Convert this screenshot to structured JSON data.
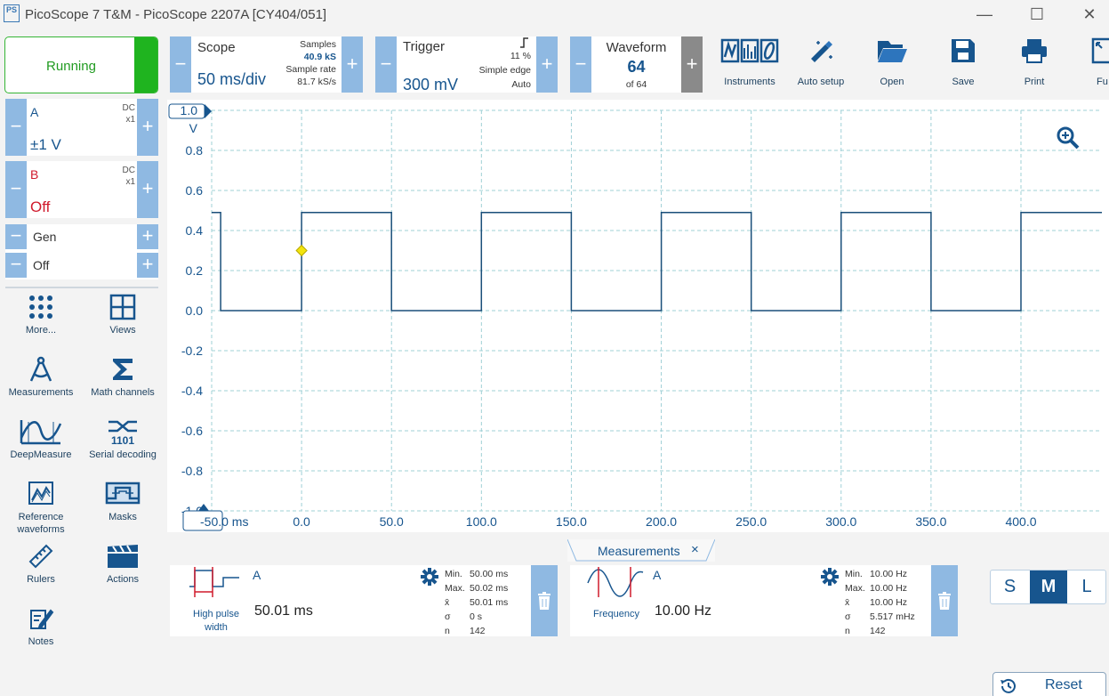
{
  "window": {
    "title": "PicoScope 7 T&M  - PicoScope 2207A [CY404/051]",
    "app_icon_text": "PS",
    "controls": [
      "—",
      "☐",
      "✕"
    ]
  },
  "run_button": {
    "label": "Running",
    "color": "#1fb41f"
  },
  "channels": [
    {
      "name": "A",
      "coupling": "DC",
      "probe": "x1",
      "range": "±1 V",
      "name_color": "#17558e"
    },
    {
      "name": "B",
      "coupling": "DC",
      "probe": "x1",
      "range": "Off",
      "name_color": "#d01a2c"
    }
  ],
  "generator": {
    "label": "Gen",
    "state": "Off"
  },
  "side_tools": [
    {
      "label": "More...",
      "icon": "grid-dots-icon"
    },
    {
      "label": "Views",
      "icon": "views-grid-icon"
    },
    {
      "label": "Measurements",
      "icon": "compass-icon"
    },
    {
      "label": "Math channels",
      "icon": "sigma-icon"
    },
    {
      "label": "DeepMeasure",
      "icon": "deepmeasure-icon"
    },
    {
      "label": "Serial decoding",
      "icon": "serial-decoding-icon"
    },
    {
      "label": "Reference waveforms",
      "icon": "reference-waveform-icon"
    },
    {
      "label": "Masks",
      "icon": "mask-icon"
    },
    {
      "label": "Rulers",
      "icon": "ruler-icon"
    },
    {
      "label": "Actions",
      "icon": "clapperboard-icon"
    },
    {
      "label": "Notes",
      "icon": "notes-icon"
    }
  ],
  "scope_panel": {
    "title": "Scope",
    "timebase": "50 ms/div",
    "samples_label": "Samples",
    "samples": "40.9 kS",
    "rate_label": "Sample rate",
    "rate": "81.7 kS/s"
  },
  "trigger_panel": {
    "title": "Trigger",
    "level": "300 mV",
    "position": "11 %",
    "type": "Simple edge",
    "mode": "Auto"
  },
  "waveform_panel": {
    "title": "Waveform",
    "current": "64",
    "of": "of 64"
  },
  "toolbar": [
    {
      "label": "Instruments",
      "icon": "instruments-icon"
    },
    {
      "label": "Auto setup",
      "icon": "auto-setup-icon"
    },
    {
      "label": "Open",
      "icon": "folder-icon"
    },
    {
      "label": "Save",
      "icon": "save-icon"
    },
    {
      "label": "Print",
      "icon": "print-icon"
    },
    {
      "label": "Fu",
      "icon": "fullscreen-icon"
    }
  ],
  "chart_data": {
    "type": "line",
    "title": "",
    "xlabel": "ms",
    "ylabel": "V",
    "xlim": [
      -50,
      445
    ],
    "ylim": [
      -1.0,
      1.0
    ],
    "x_ticks": [
      "-50.0 ms",
      "0.0",
      "50.0",
      "100.0",
      "150.0",
      "200.0",
      "250.0",
      "300.0",
      "350.0",
      "400.0"
    ],
    "x_tick_values": [
      -50,
      0,
      50,
      100,
      150,
      200,
      250,
      300,
      350,
      400
    ],
    "y_ticks": [
      "1.0",
      "0.8",
      "0.6",
      "0.4",
      "0.2",
      "0.0",
      "-0.2",
      "-0.4",
      "-0.6",
      "-0.8",
      "-1.0"
    ],
    "y_tick_values": [
      1.0,
      0.8,
      0.6,
      0.4,
      0.2,
      0.0,
      -0.2,
      -0.4,
      -0.6,
      -0.8,
      -1.0
    ],
    "grid": true,
    "series": [
      {
        "values_x": [
          -50,
          -45,
          -45,
          0,
          0,
          50,
          50,
          100,
          100,
          150,
          150,
          200,
          200,
          250,
          250,
          300,
          300,
          350,
          350,
          400,
          400,
          445
        ],
        "values_y": [
          0.49,
          0.49,
          0.0,
          0.0,
          0.49,
          0.49,
          0.0,
          0.0,
          0.49,
          0.49,
          0.0,
          0.0,
          0.49,
          0.49,
          0.0,
          0.0,
          0.49,
          0.49,
          0.0,
          0.0,
          0.49,
          0.49
        ],
        "color": "#1a4f7a"
      }
    ],
    "trigger_marker": {
      "x": 0,
      "y": 0.3,
      "color": "#f2e40e"
    },
    "axis_unit_top": "V"
  },
  "measurements_tab": {
    "label": "Measurements",
    "close": "×"
  },
  "measurements": [
    {
      "channel": "A",
      "name": "High pulse width",
      "value": "50.01 ms",
      "stats": [
        [
          "Min.",
          "50.00 ms"
        ],
        [
          "Max.",
          "50.02 ms"
        ],
        [
          "x̄",
          "50.01 ms"
        ],
        [
          "σ",
          "0 s"
        ],
        [
          "n",
          "142"
        ]
      ]
    },
    {
      "channel": "A",
      "name": "Frequency",
      "value": "10.00 Hz",
      "stats": [
        [
          "Min.",
          "10.00 Hz"
        ],
        [
          "Max.",
          "10.00 Hz"
        ],
        [
          "x̄",
          "10.00 Hz"
        ],
        [
          "σ",
          "5.517 mHz"
        ],
        [
          "n",
          "142"
        ]
      ]
    }
  ],
  "size_selector": {
    "options": [
      "S",
      "M",
      "L"
    ],
    "selected": "M"
  },
  "reset_button": {
    "label": "Reset"
  }
}
